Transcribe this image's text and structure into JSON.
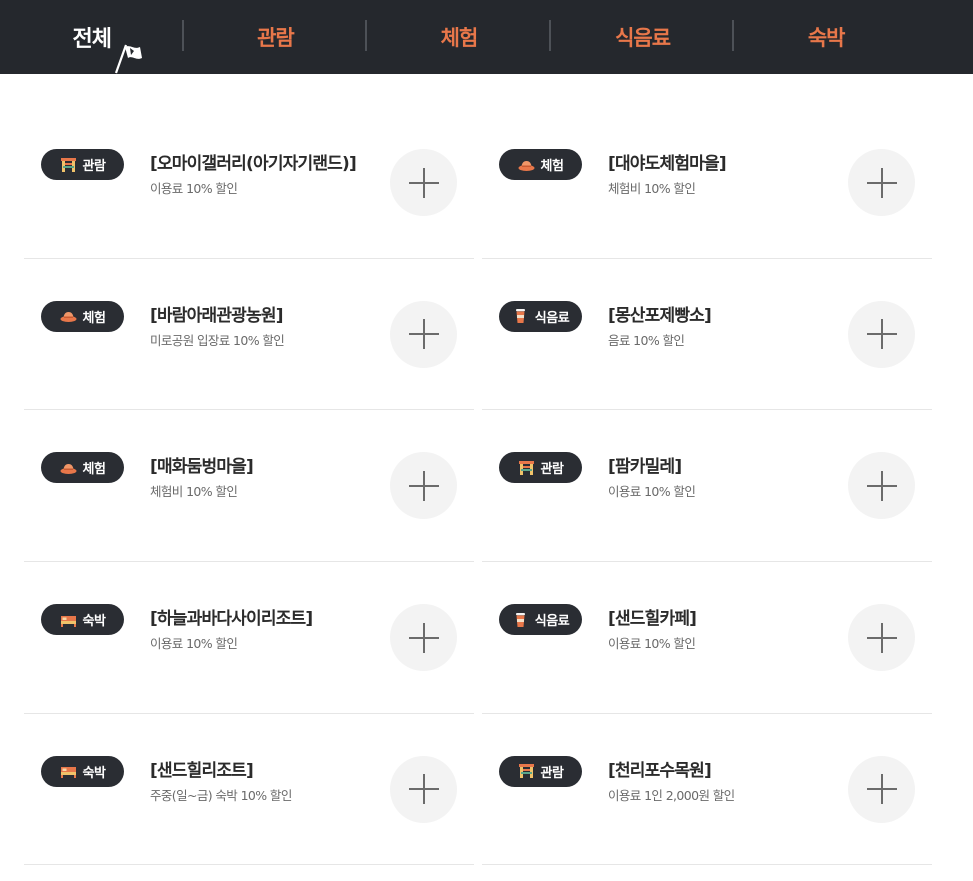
{
  "tabs": [
    {
      "label": "전체",
      "active": true
    },
    {
      "label": "관람",
      "active": false
    },
    {
      "label": "체험",
      "active": false
    },
    {
      "label": "식음료",
      "active": false
    },
    {
      "label": "숙박",
      "active": false
    }
  ],
  "colors": {
    "bar": "#25282d",
    "accent": "#e8774a",
    "badge": "#2a2d33"
  },
  "items": [
    {
      "category": "관람",
      "icon": "gate-icon",
      "title": "[오마이갤러리(아기자기랜드)]",
      "desc": "이용료 10% 할인"
    },
    {
      "category": "체험",
      "icon": "hat-icon",
      "title": "[대야도체험마을]",
      "desc": "체험비 10% 할인"
    },
    {
      "category": "체험",
      "icon": "hat-icon",
      "title": "[바람아래관광농원]",
      "desc": "미로공원 입장료 10% 할인"
    },
    {
      "category": "식음료",
      "icon": "cup-icon",
      "title": "[몽산포제빵소]",
      "desc": "음료 10% 할인"
    },
    {
      "category": "체험",
      "icon": "hat-icon",
      "title": "[매화둠벙마을]",
      "desc": "체험비 10% 할인"
    },
    {
      "category": "관람",
      "icon": "gate-icon",
      "title": "[팜카밀레]",
      "desc": "이용료 10% 할인"
    },
    {
      "category": "숙박",
      "icon": "bed-icon",
      "title": "[하늘과바다사이리조트]",
      "desc": "이용료 10% 할인"
    },
    {
      "category": "식음료",
      "icon": "cup-icon",
      "title": "[샌드힐카페]",
      "desc": "이용료 10% 할인"
    },
    {
      "category": "숙박",
      "icon": "bed-icon",
      "title": "[샌드힐리조트]",
      "desc": "주중(일~금) 숙박 10% 할인"
    },
    {
      "category": "관람",
      "icon": "gate-icon",
      "title": "[천리포수목원]",
      "desc": "이용료 1인 2,000원 할인"
    }
  ]
}
